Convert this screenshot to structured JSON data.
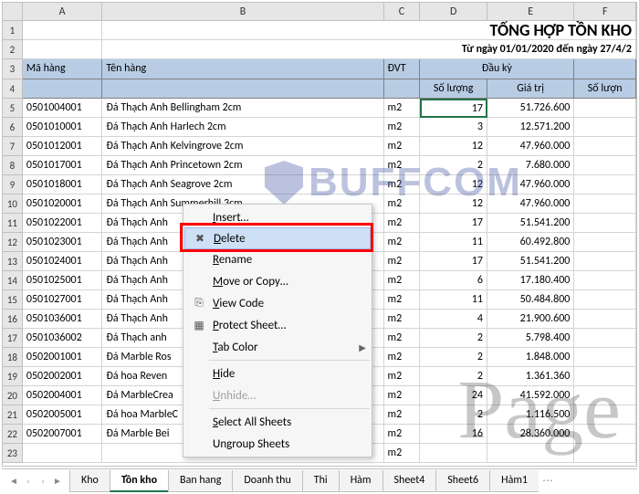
{
  "title": "TỔNG HỢP TỒN KHO",
  "subtitle": "Từ ngày 01/01/2020 đến ngày 27/4/2",
  "columns": {
    "a": "A",
    "b": "B",
    "c": "C",
    "d": "D",
    "e": "E",
    "f": "F"
  },
  "headers": {
    "ma_hang": "Mã hàng",
    "ten_hang": "Tên hàng",
    "dvt": "ĐVT",
    "dau_ky": "Đầu kỳ",
    "so_luong": "Số lượng",
    "gia_tri": "Giá trị",
    "so_luong_f": "Số lượn"
  },
  "rows": [
    {
      "r": "5",
      "ma": "0501004001",
      "ten": "Đá Thạch Anh Bellingham 2cm",
      "dvt": "m2",
      "sl": "17",
      "gt": "51.726.600"
    },
    {
      "r": "6",
      "ma": "0501010001",
      "ten": "Đá Thạch Anh Harlech 2cm",
      "dvt": "m2",
      "sl": "3",
      "gt": "12.571.200"
    },
    {
      "r": "7",
      "ma": "0501012001",
      "ten": "Đá Thạch Anh Kelvingrove 2cm",
      "dvt": "m2",
      "sl": "12",
      "gt": "47.960.000"
    },
    {
      "r": "8",
      "ma": "0501017001",
      "ten": "Đá Thạch Anh Princetown 2cm",
      "dvt": "m2",
      "sl": "2",
      "gt": "7.680.000"
    },
    {
      "r": "9",
      "ma": "0501018001",
      "ten": "Đá Thạch Anh Seagrove 2cm",
      "dvt": "m2",
      "sl": "12",
      "gt": "47.960.000"
    },
    {
      "r": "10",
      "ma": "0501020001",
      "ten": "Đá Thạch Anh Summerhill 3cm",
      "dvt": "m2",
      "sl": "12",
      "gt": "47.960.000"
    },
    {
      "r": "11",
      "ma": "0501022001",
      "ten": "Đá Thạch Anh",
      "dvt": "m2",
      "sl": "17",
      "gt": "51.541.200"
    },
    {
      "r": "12",
      "ma": "0501023001",
      "ten": "Đá Thạch Anh",
      "dvt": "m2",
      "sl": "11",
      "gt": "60.492.800"
    },
    {
      "r": "13",
      "ma": "0501024001",
      "ten": "Đá Thạch Anh",
      "dvt": "m2",
      "sl": "17",
      "gt": "51.541.200"
    },
    {
      "r": "14",
      "ma": "0501025001",
      "ten": "Đá Thạch Anh",
      "dvt": "m2",
      "sl": "6",
      "gt": "17.180.400"
    },
    {
      "r": "15",
      "ma": "0501027001",
      "ten": "Đá Thạch Anh",
      "dvt": "m2",
      "sl": "11",
      "gt": "50.484.800"
    },
    {
      "r": "16",
      "ma": "0501036001",
      "ten": "Đá Thạch Anh",
      "dvt": "m2",
      "sl": "4",
      "gt": "21.900.600"
    },
    {
      "r": "17",
      "ma": "0501036002",
      "ten": "Đá Thạch anh",
      "dvt": "m2",
      "sl": "2",
      "gt": "5.798.400"
    },
    {
      "r": "18",
      "ma": "0502001001",
      "ten": "Đá Marble Ros",
      "dvt": "m2",
      "sl": "2",
      "gt": "1.848.000"
    },
    {
      "r": "19",
      "ma": "0502002001",
      "ten": "Đá hoa Reven",
      "dvt": "m2",
      "sl": "2",
      "gt": "1.361.360"
    },
    {
      "r": "20",
      "ma": "0502004001",
      "ten": "Đá MarbleCrea",
      "dvt": "m2",
      "sl": "24",
      "gt": "41.592.000"
    },
    {
      "r": "21",
      "ma": "0502005001",
      "ten": "Đá hoa MarbleC",
      "dvt": "m2",
      "sl": "2",
      "gt": "1.116.500"
    },
    {
      "r": "22",
      "ma": "0502007001",
      "ten": "Đá Marble Bei",
      "dvt": "m2",
      "sl": "16",
      "gt": "28.360.000"
    },
    {
      "r": "23",
      "ma": "",
      "ten": "",
      "dvt": "m2",
      "sl": "",
      "gt": ""
    }
  ],
  "context_menu": {
    "insert": "Insert…",
    "delete": "Delete",
    "rename": "Rename",
    "move_copy": "Move or Copy…",
    "view_code": "View Code",
    "protect": "Protect Sheet…",
    "tab_color": "Tab Color",
    "hide": "Hide",
    "unhide": "Unhide…",
    "select_all": "Select All Sheets",
    "ungroup": "Ungroup Sheets"
  },
  "sheet_tabs": [
    "Kho",
    "Tồn kho",
    "Ban hang",
    "Doanh thu",
    "Thi",
    "Hàm",
    "Sheet4",
    "Sheet6",
    "Hàm1"
  ],
  "active_tab": "Tồn kho",
  "watermarks": {
    "brand": "BUFFCOM",
    "page": "Page"
  }
}
